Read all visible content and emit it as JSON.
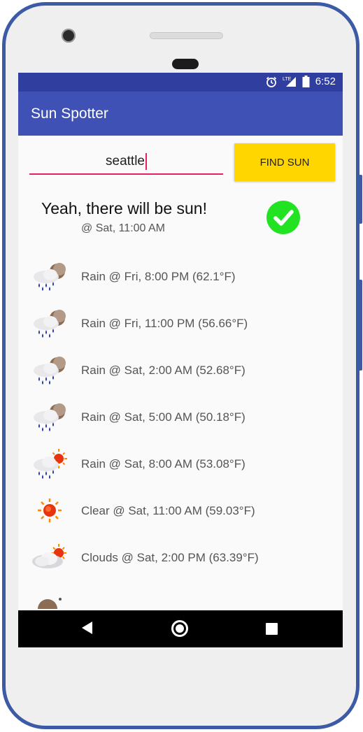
{
  "status": {
    "time": "6:52",
    "network": "LTE"
  },
  "app": {
    "title": "Sun Spotter"
  },
  "search": {
    "value": "seattle",
    "button_label": "FIND SUN"
  },
  "result": {
    "title": "Yeah, there will be sun!",
    "time": "@ Sat, 11:00 AM",
    "icon": "check-circle-icon",
    "color": "#22e321"
  },
  "colors": {
    "appbar": "#3f51b5",
    "statusbar": "#303f9f",
    "accent": "#e91e63",
    "button": "#ffd600"
  },
  "forecast": [
    {
      "text": "Rain @ Fri, 8:00 PM (62.1°F)",
      "icon": "rain-night-icon"
    },
    {
      "text": "Rain @ Fri, 11:00 PM (56.66°F)",
      "icon": "rain-night-icon"
    },
    {
      "text": "Rain @ Sat, 2:00 AM (52.68°F)",
      "icon": "rain-night-icon"
    },
    {
      "text": "Rain @ Sat, 5:00 AM (50.18°F)",
      "icon": "rain-night-icon"
    },
    {
      "text": "Rain @ Sat, 8:00 AM (53.08°F)",
      "icon": "rain-sun-icon"
    },
    {
      "text": "Clear @ Sat, 11:00 AM (59.03°F)",
      "icon": "sun-icon"
    },
    {
      "text": "Clouds @ Sat, 2:00 PM (63.39°F)",
      "icon": "cloud-sun-icon"
    }
  ]
}
